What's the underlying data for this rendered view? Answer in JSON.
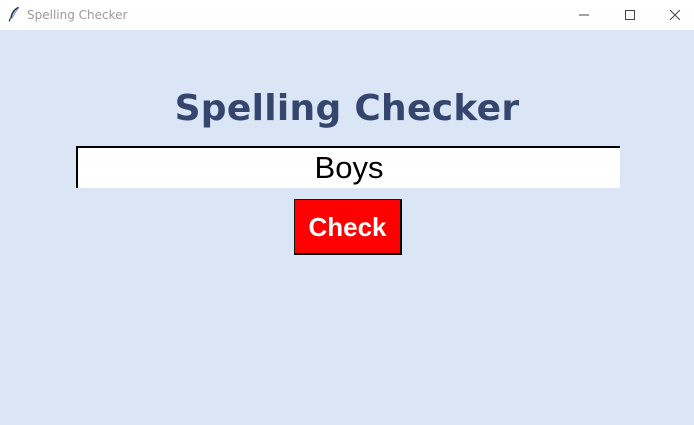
{
  "window": {
    "title": "Spelling Checker",
    "icons": {
      "app": "feather-icon",
      "minimize": "minimize-icon",
      "maximize": "maximize-icon",
      "close": "close-icon"
    }
  },
  "main": {
    "heading": "Spelling Checker",
    "word_input": {
      "value": "Boys"
    },
    "check_button_label": "Check"
  },
  "colors": {
    "background": "#dae5f5",
    "heading": "#35466e",
    "button": "#ff0000",
    "button_text": "#ffffff"
  }
}
